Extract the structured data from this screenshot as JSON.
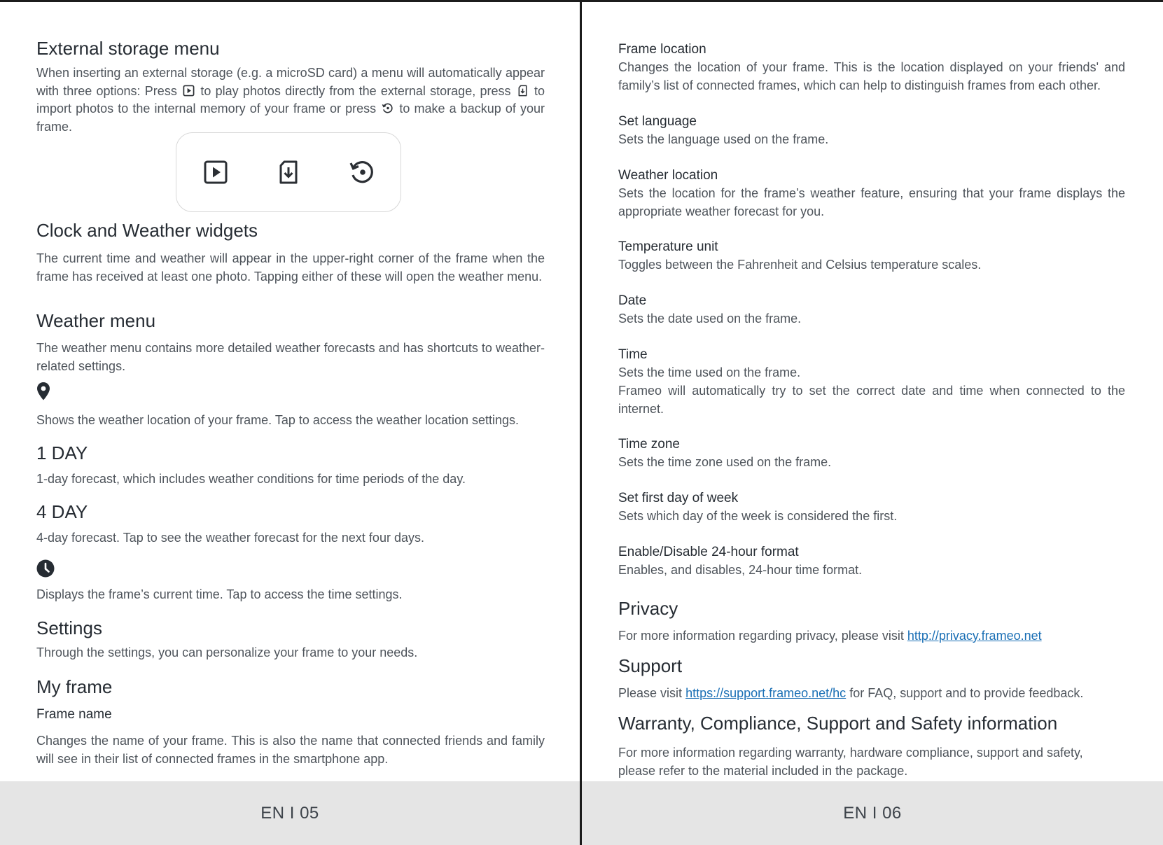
{
  "left_page": {
    "external_storage": {
      "heading": "External storage menu",
      "text_1": "When inserting an external storage (e.g. a microSD card) a menu will automatically appear with three options: Press",
      "text_2": "to play photos directly from the external storage, press",
      "text_3": "to import photos to the internal memory of your frame or press",
      "text_4": "to make a backup of your frame.",
      "menu_icons": [
        "play-icon",
        "import-icon",
        "backup-icon"
      ]
    },
    "clock_weather": {
      "heading": "Clock and Weather widgets",
      "text": "The current time and weather will appear in the upper-right corner of the frame when the frame has received at least one photo. Tapping either of these will open the weather menu."
    },
    "weather_menu": {
      "heading": "Weather menu",
      "text": "The weather menu contains more detailed weather forecasts and has shortcuts to weather-related settings.",
      "location_icon": "location-pin-icon",
      "location_text": "Shows the weather location of your frame. Tap to access the weather location settings."
    },
    "one_day": {
      "heading": "1 DAY",
      "text": "1-day forecast, which includes weather conditions for time periods of the day."
    },
    "four_day": {
      "heading": "4 DAY",
      "text": "4-day forecast. Tap to see the weather forecast for the next four days.",
      "clock_icon": "clock-icon",
      "clock_text": "Displays the frame’s current time. Tap to access the time settings."
    },
    "settings": {
      "heading": "Settings",
      "text": "Through the settings, you can personalize your frame to your needs."
    },
    "my_frame": {
      "heading": "My frame",
      "frame_name_title": "Frame name",
      "frame_name_text": "Changes the name of your frame. This is also the name that connected friends and family will see in their list of connected frames in the smartphone app."
    },
    "footer": "EN I 05"
  },
  "right_page": {
    "items": [
      {
        "title": "Frame location",
        "text": "Changes the location of your frame. This is the location displayed on your friends' and family’s list of connected frames, which can help to distinguish frames from each other."
      },
      {
        "title": "Set language",
        "text": "Sets the language used on the frame."
      },
      {
        "title": "Weather location",
        "text": "Sets the location for the frame’s weather feature, ensuring that your frame displays the appropriate weather forecast for you."
      },
      {
        "title": "Temperature unit",
        "text": "Toggles between the Fahrenheit and Celsius temperature scales."
      },
      {
        "title": "Date",
        "text": "Sets the date used on the frame."
      },
      {
        "title": "Time",
        "text": "Sets the time used on the frame.",
        "text_2": "Frameo will automatically try to set the correct date and time when connected to the internet."
      },
      {
        "title": "Time zone",
        "text": "Sets the time zone used on the frame."
      },
      {
        "title": "Set first day of week",
        "text": "Sets which day of the week is considered the first."
      },
      {
        "title": "Enable/Disable 24-hour format",
        "text": "Enables, and disables, 24-hour time format."
      }
    ],
    "privacy": {
      "heading": "Privacy",
      "text": "For more information regarding privacy, please visit",
      "link": "http://privacy.frameo.net"
    },
    "support": {
      "heading": "Support",
      "text_before": "Please visit",
      "link": "https://support.frameo.net/hc",
      "text_after": "for FAQ, support and to provide feedback."
    },
    "warranty": {
      "heading": "Warranty, Compliance, Support and Safety information",
      "text": "For more information regarding warranty, hardware compliance, support and safety, please refer to the material included in the package."
    },
    "footer": "EN I 06"
  }
}
